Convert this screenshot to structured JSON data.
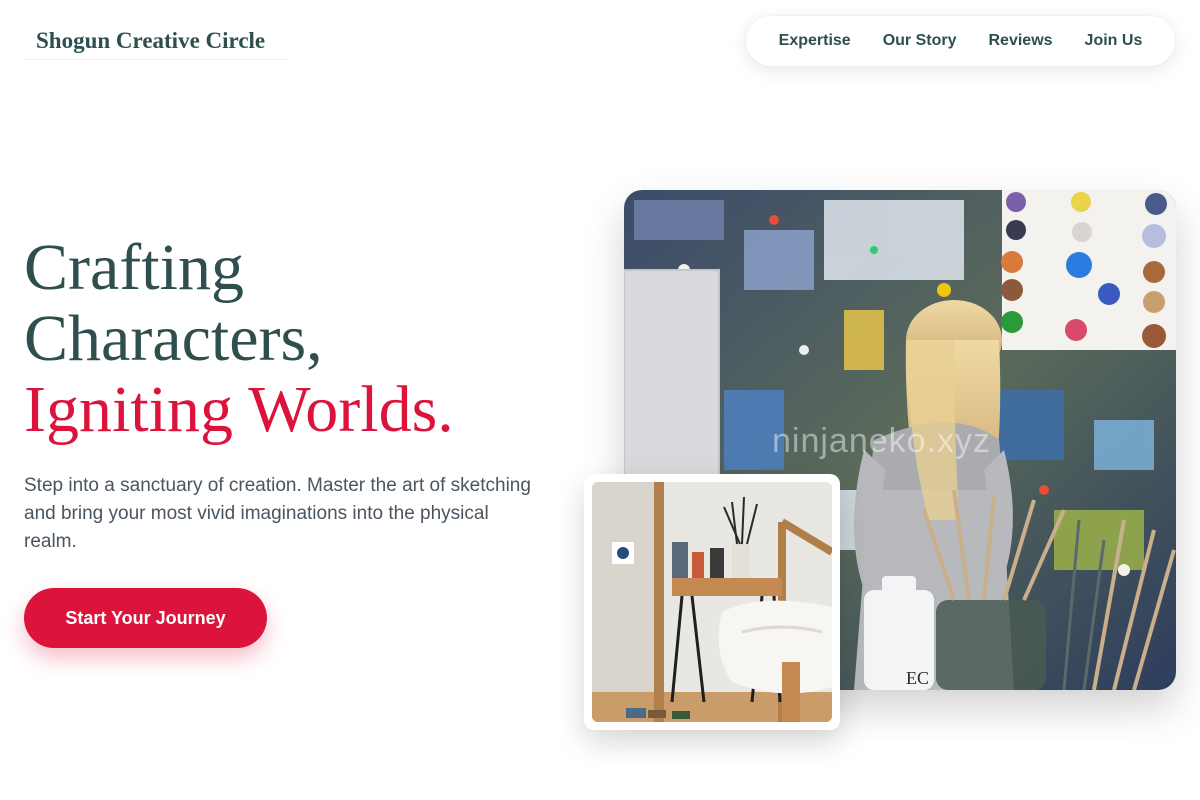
{
  "brand": {
    "name": "Shogun Creative Circle"
  },
  "nav": {
    "items": [
      {
        "label": "Expertise"
      },
      {
        "label": "Our Story"
      },
      {
        "label": "Reviews"
      },
      {
        "label": "Join Us"
      }
    ]
  },
  "hero": {
    "title_line_1": "Crafting",
    "title_line_2": "Characters,",
    "title_accent": "Igniting Worlds.",
    "description": "Step into a sanctuary of creation. Master the art of sketching and bring your most vivid imaginations into the physical realm.",
    "cta_label": "Start Your Journey"
  },
  "images": {
    "main_watermark": "ninjaneko.xyz"
  },
  "colors": {
    "primary_text": "#2f4f4f",
    "accent": "#dc143c",
    "body_text": "#4a5560",
    "background": "#ffffff"
  }
}
